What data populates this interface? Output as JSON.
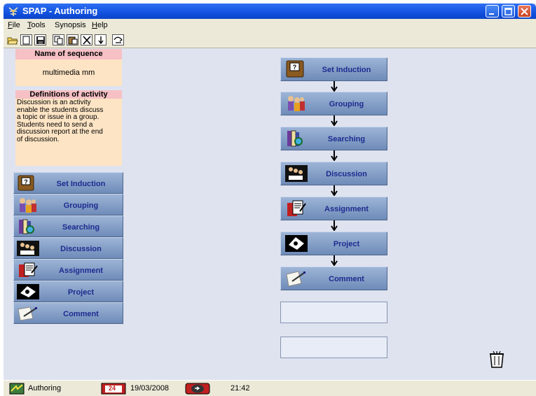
{
  "window": {
    "title": "SPAP - Authoring",
    "app_icon": "antenna-icon"
  },
  "menu": [
    {
      "label": "File",
      "underline": "F"
    },
    {
      "label": "Tools",
      "underline": "T"
    },
    {
      "label": "Synopsis",
      "underline": ""
    },
    {
      "label": "Help",
      "underline": "H"
    }
  ],
  "toolbar": {
    "icons": [
      "open-folder-icon",
      "new-document-icon",
      "save-icon",
      "copy-icon",
      "paste-icon",
      "delete-icon",
      "move-down-icon",
      "run-icon"
    ]
  },
  "sequence": {
    "header": "Name of sequence",
    "name": "multimedia mm"
  },
  "definition": {
    "header": "Definitions of activity",
    "text": "Discussion is an activity\nenable the students discuss\na topic or issue in a group.\nStudents need to send a\ndiscussion report at the end\nof discussion."
  },
  "palette": [
    {
      "label": "Set Induction",
      "icon": "question-book-icon"
    },
    {
      "label": "Grouping",
      "icon": "group-people-icon"
    },
    {
      "label": "Searching",
      "icon": "search-books-icon"
    },
    {
      "label": "Discussion",
      "icon": "discussion-icon"
    },
    {
      "label": "Assignment",
      "icon": "assignment-icon"
    },
    {
      "label": "Project",
      "icon": "project-icon"
    },
    {
      "label": "Comment",
      "icon": "comment-pen-icon"
    }
  ],
  "flow": [
    {
      "label": "Set Induction",
      "icon": "question-book-icon"
    },
    {
      "label": "Grouping",
      "icon": "group-people-icon"
    },
    {
      "label": "Searching",
      "icon": "search-books-icon"
    },
    {
      "label": "Discussion",
      "icon": "discussion-icon"
    },
    {
      "label": "Assignment",
      "icon": "assignment-icon"
    },
    {
      "label": "Project",
      "icon": "project-icon"
    },
    {
      "label": "Comment",
      "icon": "comment-pen-icon"
    }
  ],
  "status": {
    "mode": "Authoring",
    "date": "19/03/2008",
    "calendar_day": "24",
    "time": "21:42"
  },
  "colors": {
    "titlebar": "#1252e0",
    "background": "#dfe3f0",
    "panel": "#fde4c4",
    "panel_header": "#f6c0c4",
    "button": "#8aa3c9",
    "button_text": "#1d2b90"
  }
}
